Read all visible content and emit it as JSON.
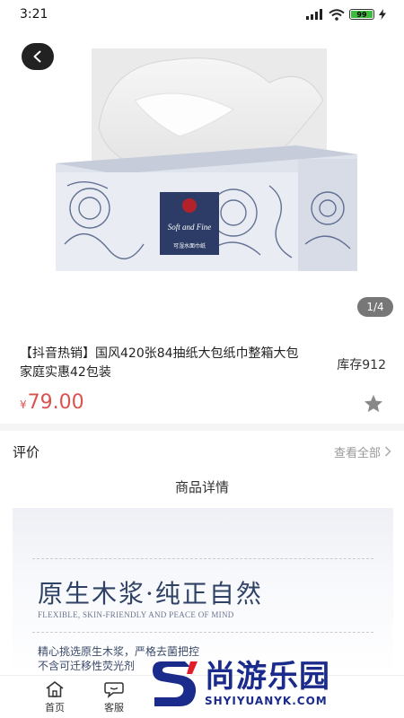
{
  "status_bar": {
    "time": "3:21",
    "battery": "99"
  },
  "hero": {
    "pager": "1/4",
    "package_brand": "Soft and Fine",
    "package_caption": "可湿水面巾纸"
  },
  "product": {
    "title": "【抖音热销】国风420张84抽纸大包纸巾整箱大包家庭实惠42包装",
    "stock": "库存912",
    "price_symbol": "¥",
    "price": "79.00"
  },
  "reviews": {
    "label": "评价",
    "view_all": "查看全部"
  },
  "details": {
    "heading": "商品详情",
    "banner_title": "原生木浆·纯正自然",
    "banner_subtitle": "FLEXIBLE, SKIN-FRIENDLY AND PEACE OF MIND",
    "banner_line1": "精心挑选原生木浆，严格去菌把控",
    "banner_line2": "不含可迁移性荧光剂"
  },
  "bottom_nav": [
    {
      "label": "首页",
      "icon": "home-icon"
    },
    {
      "label": "客服",
      "icon": "chat-icon"
    }
  ],
  "watermark": {
    "cn": "尚游乐园",
    "en": "SHYIYUANYK.COM"
  },
  "colors": {
    "price": "#d9534f",
    "banner_text": "#2f4266",
    "watermark": "#1a2b8c"
  }
}
